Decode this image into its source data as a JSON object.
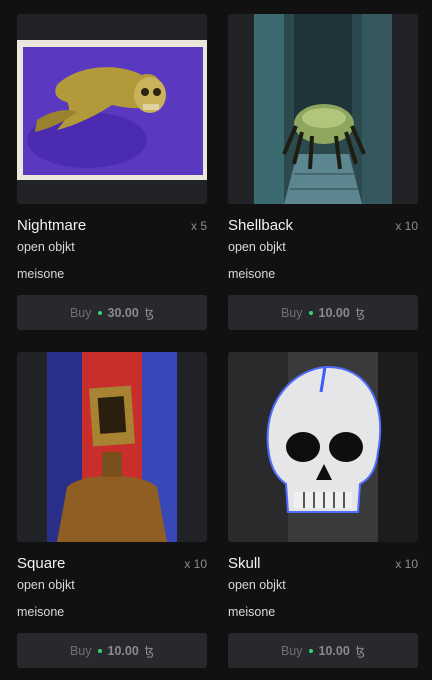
{
  "colors": {
    "background": "#111112",
    "card_thumb_bg": "#222327",
    "button_bg": "#28292c",
    "dot_green": "#3bd16f"
  },
  "items": [
    {
      "title": "Nightmare",
      "editions": "x 5",
      "status": "open objkt",
      "artist": "meisone",
      "buy_label": "Buy",
      "price": "30.00",
      "currency": "ꜩ",
      "artwork": "yellow-skull-fish-painting"
    },
    {
      "title": "Shellback",
      "editions": "x 10",
      "status": "open objkt",
      "artist": "meisone",
      "buy_label": "Buy",
      "price": "10.00",
      "currency": "ꜩ",
      "artwork": "crab-creature-corridor-painting"
    },
    {
      "title": "Square",
      "editions": "x 10",
      "status": "open objkt",
      "artist": "meisone",
      "buy_label": "Buy",
      "price": "10.00",
      "currency": "ꜩ",
      "artwork": "square-head-figure-painting"
    },
    {
      "title": "Skull",
      "editions": "x 10",
      "status": "open objkt",
      "artist": "meisone",
      "buy_label": "Buy",
      "price": "10.00",
      "currency": "ꜩ",
      "artwork": "white-skull-painting"
    }
  ]
}
